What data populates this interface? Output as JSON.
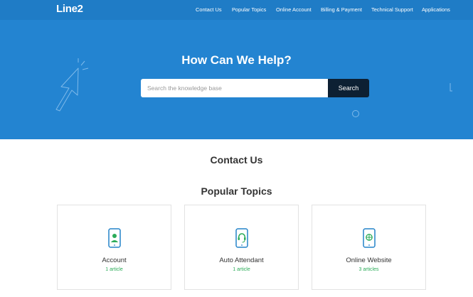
{
  "brand": {
    "logo": "Line2"
  },
  "nav": {
    "items": [
      {
        "label": "Contact Us"
      },
      {
        "label": "Popular Topics"
      },
      {
        "label": "Online Account"
      },
      {
        "label": "Billing & Payment"
      },
      {
        "label": "Technical Support"
      },
      {
        "label": "Applications"
      }
    ]
  },
  "hero": {
    "title": "How Can We Help?",
    "search_placeholder": "Search the knowledge base",
    "search_value": "",
    "search_button": "Search"
  },
  "sections": {
    "contact": "Contact Us",
    "popular": "Popular Topics"
  },
  "cards": [
    {
      "title": "Account",
      "count": "1 article",
      "icon": "phone-user-icon"
    },
    {
      "title": "Auto Attendant",
      "count": "1 article",
      "icon": "phone-headset-icon"
    },
    {
      "title": "Online Website",
      "count": "3 articles",
      "icon": "phone-globe-icon"
    }
  ],
  "colors": {
    "topbar": "#1f7cc6",
    "hero": "#2384d1",
    "search_button": "#0d2033",
    "article_count": "#2bab58",
    "icon_primary": "#2383c9",
    "icon_accent": "#2bab58"
  }
}
